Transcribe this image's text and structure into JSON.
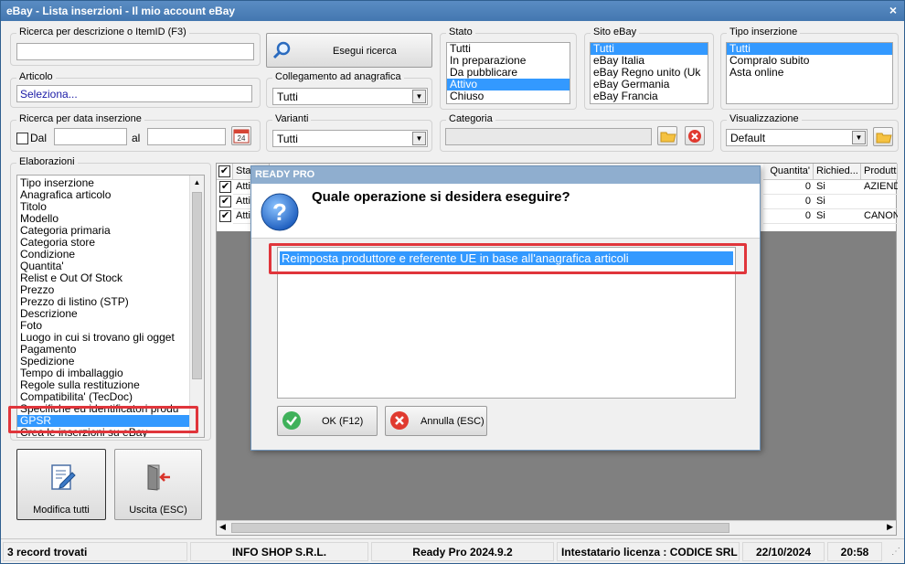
{
  "window": {
    "title": "eBay - Lista inserzioni - Il mio account eBay",
    "close_glyph": "×"
  },
  "search": {
    "desc_label": "Ricerca per descrizione o ItemID (F3)",
    "desc_value": "",
    "button_label": "Esegui ricerca",
    "articolo_label": "Articolo",
    "articolo_value": "Seleziona...",
    "collegamento_label": "Collegamento ad anagrafica",
    "collegamento_value": "Tutti",
    "data_label": "Ricerca per data inserzione",
    "dal_label": "Dal",
    "al_label": "al",
    "varianti_label": "Varianti",
    "varianti_value": "Tutti",
    "categoria_label": "Categoria",
    "visualizzazione_label": "Visualizzazione",
    "visualizzazione_value": "Default",
    "calendar_day": "24"
  },
  "stato": {
    "label": "Stato",
    "items": [
      "Tutti",
      "In preparazione",
      "Da pubblicare",
      "Attivo",
      "Chiuso"
    ]
  },
  "sito": {
    "label": "Sito eBay",
    "items": [
      "Tutti",
      "eBay Italia",
      "eBay Regno unito (Uk",
      "eBay Germania",
      "eBay Francia"
    ]
  },
  "tipo": {
    "label": "Tipo inserzione",
    "items": [
      "Tutti",
      "Compralo subito",
      "Asta online"
    ]
  },
  "elaborazioni": {
    "label": "Elaborazioni",
    "items": [
      "Tipo inserzione",
      "Anagrafica articolo",
      "Titolo",
      "Modello",
      "Categoria primaria",
      "Categoria store",
      "Condizione",
      "Quantita'",
      "Relist e Out Of Stock",
      "Prezzo",
      "Prezzo di listino (STP)",
      "Descrizione",
      "Foto",
      "Luogo in cui si trovano gli ogget",
      "Pagamento",
      "Spedizione",
      "Tempo di imballaggio",
      "Regole sulla restituzione",
      "Compatibilita' (TecDoc)",
      "Specifiche eu identificatori produ",
      "GPSR",
      "Crea le inserzioni su eBay"
    ],
    "modifica_label": "Modifica tutti",
    "uscita_label": "Uscita (ESC)"
  },
  "grid": {
    "headers": [
      "Sta",
      "Quantita'",
      "Richied...",
      "Produtto"
    ],
    "rows": [
      {
        "stato": "Atti",
        "quantita": "0",
        "richiesto": "Si",
        "produttore": "AZIENDA"
      },
      {
        "stato": "Atti",
        "quantita": "0",
        "richiesto": "Si",
        "produttore": ""
      },
      {
        "stato": "Atti",
        "quantita": "0",
        "richiesto": "Si",
        "produttore": "CANON"
      }
    ]
  },
  "dialog": {
    "title": "READY PRO",
    "question_glyph": "?",
    "question": "Quale operazione si desidera eseguire?",
    "options": [
      "Reimposta produttore e referente UE in base all'anagrafica articoli"
    ],
    "ok_label": "OK (F12)",
    "cancel_label": "Annulla (ESC)"
  },
  "status": {
    "records": "3 record trovati",
    "company": "INFO SHOP S.R.L.",
    "version": "Ready Pro 2024.9.2",
    "license": "Intestatario licenza : CODICE SRL",
    "date": "22/10/2024",
    "time": "20:58"
  },
  "colors": {
    "title_bar": "#4a7fb8",
    "selection": "#3399ff",
    "highlight": "#e0353b",
    "dialog_title": "#8faecf"
  }
}
